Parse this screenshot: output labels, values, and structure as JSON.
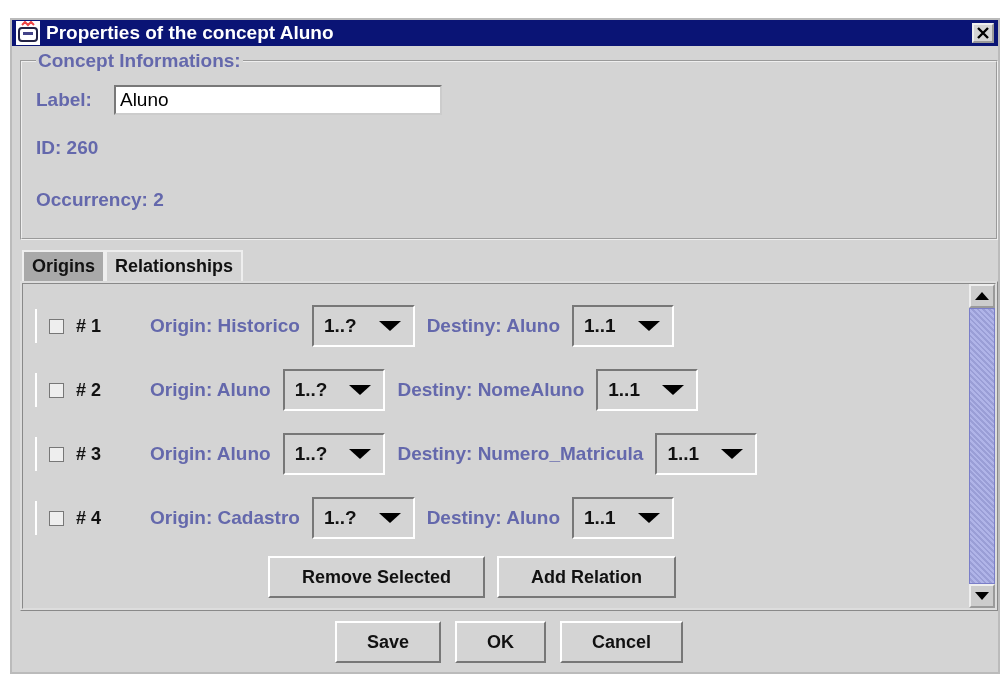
{
  "window": {
    "title": "Properties of the concept Aluno"
  },
  "concept_info": {
    "title": "Concept Informations:",
    "label_caption": "Label:",
    "label_value": "Aluno",
    "id": "ID: 260",
    "occurrency": "Occurrency: 2"
  },
  "tabs": [
    {
      "label": "Origins",
      "selected": false
    },
    {
      "label": "Relationships",
      "selected": true
    }
  ],
  "relations": [
    {
      "checked": false,
      "number": "# 1",
      "origin": "Origin: Historico",
      "origin_card": "1..?",
      "destiny": "Destiny: Aluno",
      "destiny_card": "1..1"
    },
    {
      "checked": false,
      "number": "# 2",
      "origin": "Origin: Aluno",
      "origin_card": "1..?",
      "destiny": "Destiny: NomeAluno",
      "destiny_card": "1..1"
    },
    {
      "checked": false,
      "number": "# 3",
      "origin": "Origin: Aluno",
      "origin_card": "1..?",
      "destiny": "Destiny: Numero_Matricula",
      "destiny_card": "1..1"
    },
    {
      "checked": false,
      "number": "# 4",
      "origin": "Origin: Cadastro",
      "origin_card": "1..?",
      "destiny": "Destiny: Aluno",
      "destiny_card": "1..1"
    }
  ],
  "panel_buttons": [
    "Remove Selected",
    "Add Relation"
  ],
  "buttons": [
    "Save",
    "OK",
    "Cancel"
  ]
}
